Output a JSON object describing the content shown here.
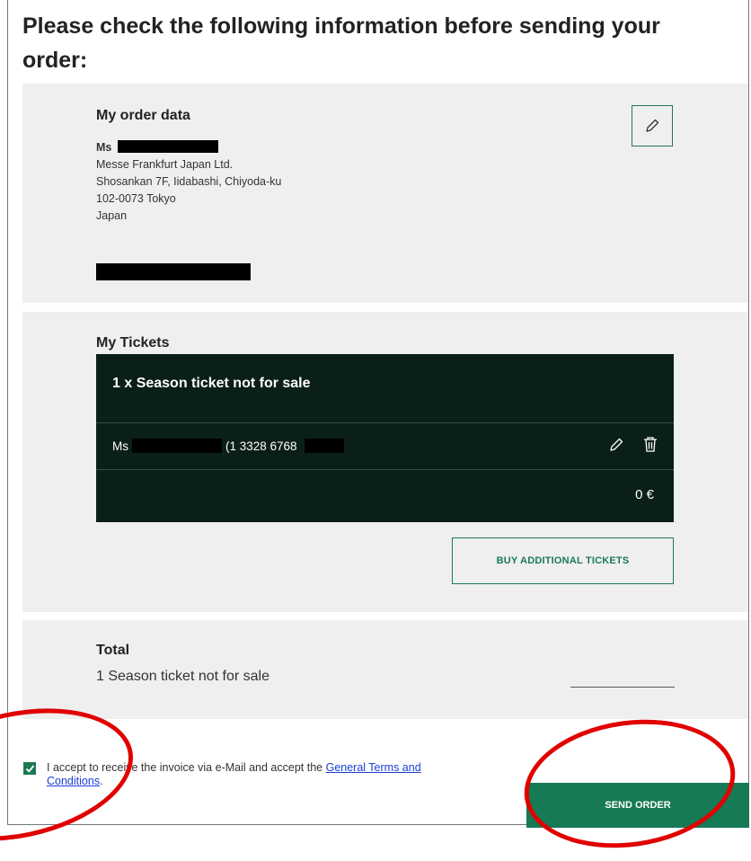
{
  "header": {
    "title": "Please check the following information before sending your order:"
  },
  "order_data": {
    "title": "My order data",
    "salutation": "Ms",
    "company": "Messe Frankfurt Japan Ltd.",
    "street": "Shosankan 7F, Iidabashi, Chiyoda-ku",
    "postal_city": "102-0073 Tokyo",
    "country": "Japan",
    "edit_icon": "pencil-icon"
  },
  "tickets": {
    "title": "My Tickets",
    "ticket_title": "1 x Season ticket not for sale",
    "holder_salutation": "Ms",
    "holder_number": "(1 3328 6768",
    "price": "0 €",
    "edit_icon": "pencil-icon",
    "delete_icon": "trash-icon",
    "buy_label": "BUY ADDITIONAL TICKETS"
  },
  "total": {
    "title": "Total",
    "line": "1 Season ticket not for sale"
  },
  "footer": {
    "accept_text": "I accept to receive the invoice via e-Mail and accept the ",
    "terms_link": "General Terms and Conditions",
    "period": ".",
    "send_label": "SEND ORDER",
    "checkbox_checked": true
  },
  "colors": {
    "accent": "#167a54",
    "panel": "#efefef",
    "ticket_bg": "#0b1f19",
    "annotation": "#e00000"
  }
}
